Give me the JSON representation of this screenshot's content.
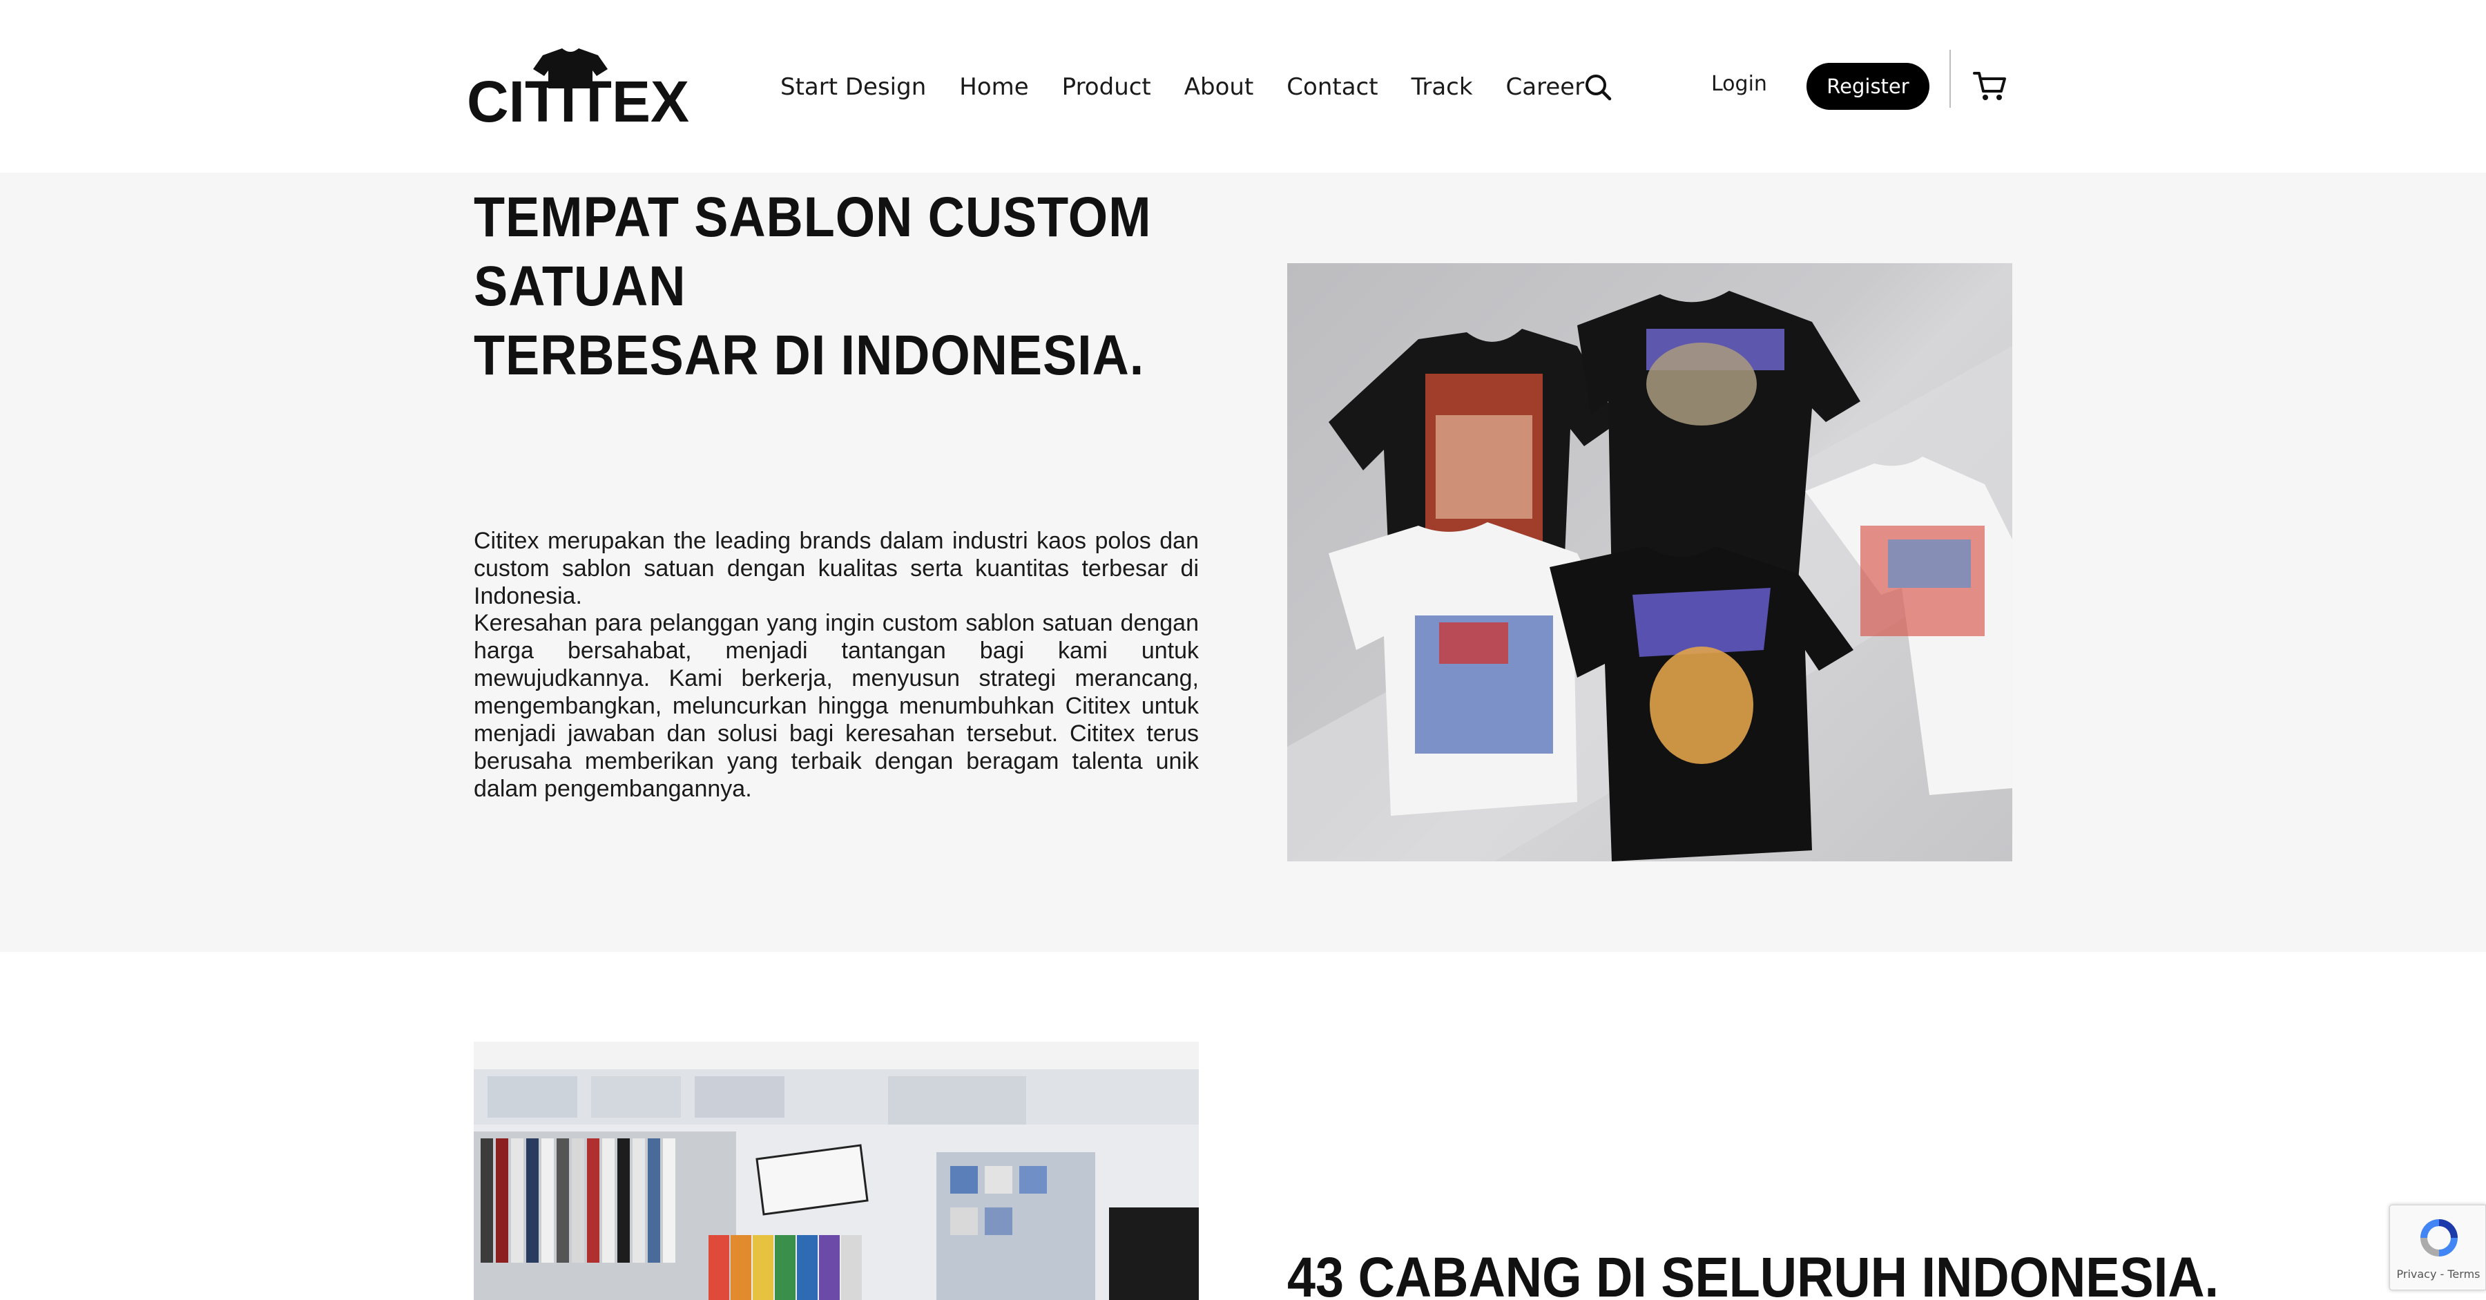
{
  "header": {
    "logo_text": "CITITEX",
    "nav": [
      "Start Design",
      "Home",
      "Product",
      "About",
      "Contact",
      "Track",
      "Career"
    ],
    "search_icon": "search-icon",
    "login_label": "Login",
    "register_label": "Register",
    "cart_icon": "cart-icon"
  },
  "hero": {
    "title_line1": "TEMPAT SABLON CUSTOM SATUAN",
    "title_line2": "TERBESAR DI INDONESIA.",
    "paragraph1": "Cititex merupakan the leading brands dalam industri kaos polos dan custom sablon satuan dengan kualitas serta kuantitas terbesar di Indonesia.",
    "paragraph2": "Keresahan para pelanggan yang ingin custom sablon satuan dengan harga bersahabat, menjadi tantangan bagi kami untuk mewujudkannya. Kami berkerja, menyusun strategi merancang, mengembangkan, meluncurkan hingga menumbuhkan Cititex untuk menjadi jawaban dan solusi bagi keresahan tersebut. Cititex terus berusaha memberikan yang terbaik dengan beragam talenta unik dalam pengembangannya."
  },
  "branches": {
    "title": "43 CABANG DI SELURUH INDONESIA."
  },
  "recaptcha": {
    "links": "Privacy - Terms"
  }
}
